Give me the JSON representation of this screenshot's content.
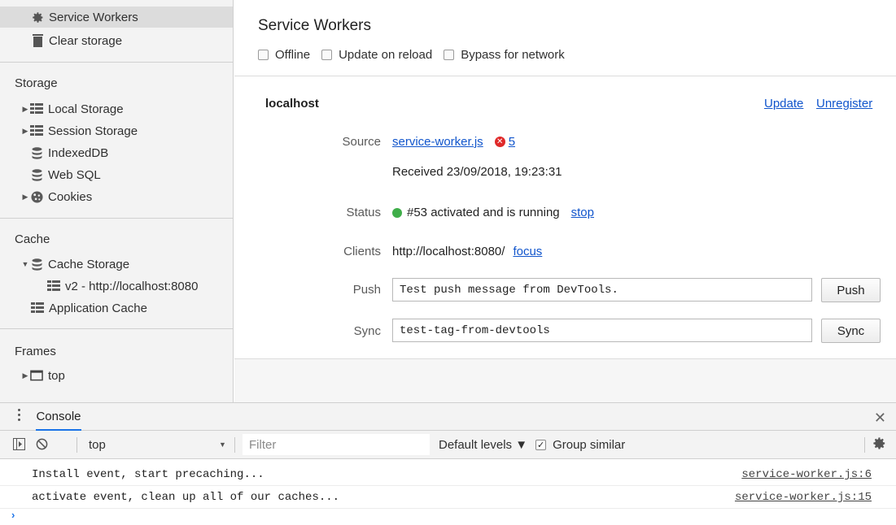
{
  "sidebar": {
    "top_items": [
      {
        "label": "Service Workers",
        "icon": "gear-icon",
        "selected": true
      },
      {
        "label": "Clear storage",
        "icon": "trash-icon",
        "selected": false
      }
    ],
    "storage": {
      "title": "Storage",
      "items": [
        {
          "label": "Local Storage",
          "icon": "grid-icon",
          "expandable": true
        },
        {
          "label": "Session Storage",
          "icon": "grid-icon",
          "expandable": true
        },
        {
          "label": "IndexedDB",
          "icon": "database-icon",
          "expandable": false
        },
        {
          "label": "Web SQL",
          "icon": "database-icon",
          "expandable": false
        },
        {
          "label": "Cookies",
          "icon": "cookie-icon",
          "expandable": true
        }
      ]
    },
    "cache": {
      "title": "Cache",
      "items": [
        {
          "label": "Cache Storage",
          "icon": "database-icon",
          "expanded": true
        },
        {
          "label": "v2 - http://localhost:8080",
          "icon": "grid-icon"
        },
        {
          "label": "Application Cache",
          "icon": "grid-icon"
        }
      ]
    },
    "frames": {
      "title": "Frames",
      "items": [
        {
          "label": "top",
          "icon": "frame-icon",
          "expandable": true
        }
      ]
    }
  },
  "main": {
    "title": "Service Workers",
    "options": [
      {
        "label": "Offline",
        "checked": false
      },
      {
        "label": "Update on reload",
        "checked": false
      },
      {
        "label": "Bypass for network",
        "checked": false
      }
    ],
    "origin": "localhost",
    "update_link": "Update",
    "unregister_link": "Unregister",
    "source_label": "Source",
    "source_file": "service-worker.js",
    "error_count": "5",
    "received": "Received 23/09/2018, 19:23:31",
    "status_label": "Status",
    "status_text": "#53 activated and is running",
    "stop_link": "stop",
    "clients_label": "Clients",
    "clients_url": "http://localhost:8080/",
    "focus_link": "focus",
    "push_label": "Push",
    "push_value": "Test push message from DevTools.",
    "push_button": "Push",
    "sync_label": "Sync",
    "sync_value": "test-tag-from-devtools",
    "sync_button": "Sync",
    "status_color": "#3fae49"
  },
  "console": {
    "tab_label": "Console",
    "context": "top",
    "filter_placeholder": "Filter",
    "levels": "Default levels ▼",
    "group_similar": "Group similar",
    "group_similar_checked": true,
    "messages": [
      {
        "text": "Install event, start precaching...",
        "source": "service-worker.js:6"
      },
      {
        "text": "activate event, clean up all of our caches...",
        "source": "service-worker.js:15"
      }
    ],
    "prompt": "›"
  }
}
